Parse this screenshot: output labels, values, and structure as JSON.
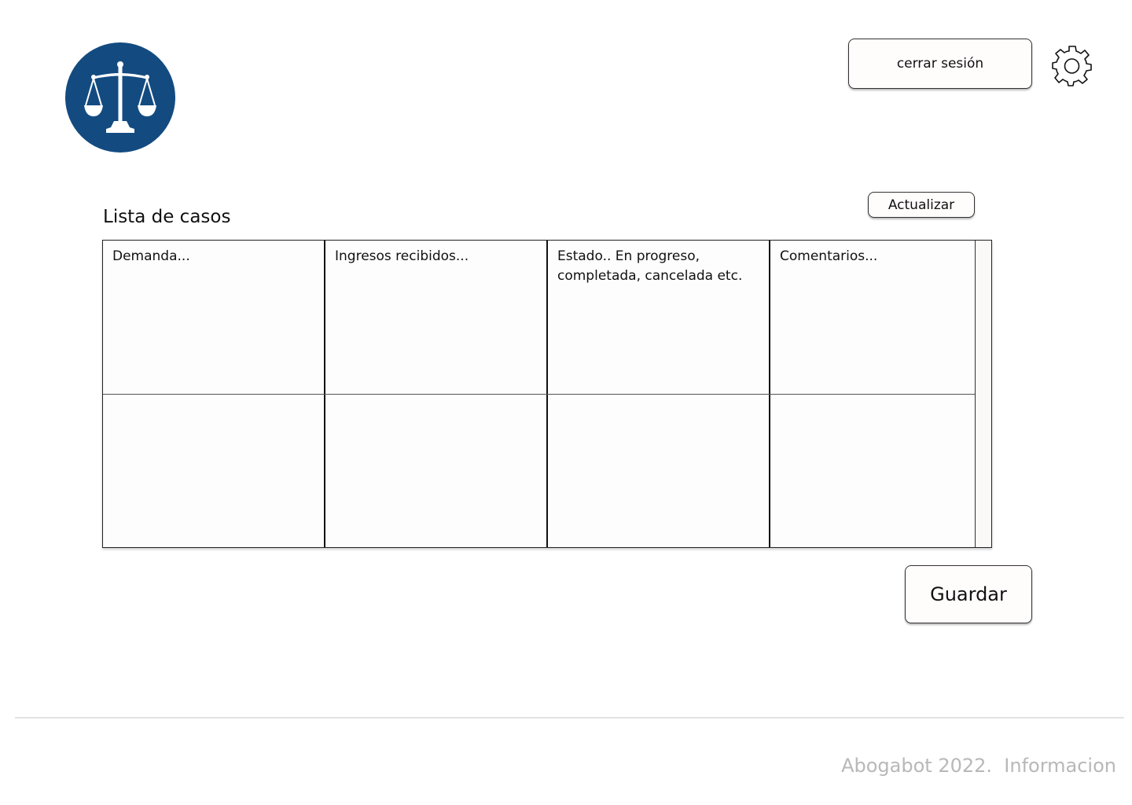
{
  "header": {
    "logo_icon": "scales-of-justice-icon",
    "logout_label": "cerrar sesión",
    "settings_icon": "gear-icon",
    "brand_color": "#134b80"
  },
  "main": {
    "title": "Lista de casos",
    "update_label": "Actualizar",
    "table": {
      "rows": [
        [
          "Demanda...",
          "Ingresos recibidos...",
          "Estado.. En progreso, completada, cancelada etc.",
          "Comentarios..."
        ],
        [
          "",
          "",
          "",
          ""
        ]
      ]
    },
    "save_label": "Guardar"
  },
  "footer": {
    "text": "Abogabot 2022.  Informacion"
  }
}
